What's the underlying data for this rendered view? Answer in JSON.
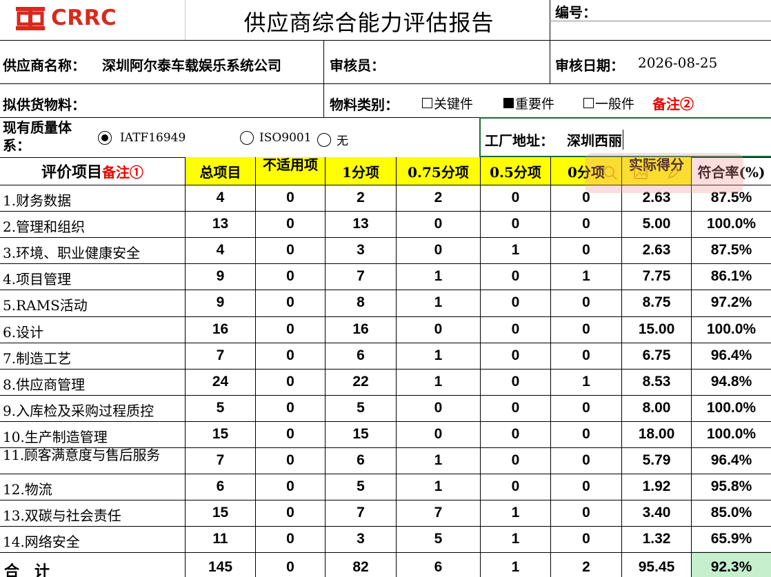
{
  "header": {
    "logo_text": "CRRC",
    "title": "供应商综合能力评估报告",
    "number_label": "编号："
  },
  "info": {
    "supplier_label": "供应商名称：",
    "supplier_name": "深圳阿尔泰车载娱乐系统公司",
    "reviewer_label": "审核员：",
    "review_date_label": "审核日期：",
    "review_date": "2026-08-25",
    "material_label": "拟供货物料：",
    "material_category_label": "物料类别：",
    "categories": [
      {
        "label": "关键件",
        "checked": false
      },
      {
        "label": "重要件",
        "checked": true
      },
      {
        "label": "一般件",
        "checked": false
      }
    ],
    "remark2": "备注②",
    "quality_system_label_1": "现有质量体",
    "quality_system_label_2": "系：",
    "quality_systems": [
      {
        "label": "IATF16949",
        "selected": true
      },
      {
        "label": "ISO9001",
        "selected": false
      },
      {
        "label": "无",
        "selected": false
      }
    ],
    "factory_address_label": "工厂地址：",
    "factory_address": "深圳西丽"
  },
  "table": {
    "header": {
      "item": "评价项目",
      "item_remark": "备注①",
      "total": "总项目",
      "na": "不适用项",
      "one": "1分项",
      "three_quarter": "0.75分项",
      "half": "0.5分项",
      "zero": "0分项",
      "score": "实际得分",
      "rate": "符合率(%)"
    },
    "rows": [
      {
        "name": "1.财务数据",
        "total": "4",
        "na": "0",
        "one": "2",
        "tq": "2",
        "half": "0",
        "zero": "0",
        "score": "2.63",
        "rate": "87.5%"
      },
      {
        "name": "2.管理和组织",
        "total": "13",
        "na": "0",
        "one": "13",
        "tq": "0",
        "half": "0",
        "zero": "0",
        "score": "5.00",
        "rate": "100.0%"
      },
      {
        "name": "3.环境、职业健康安全",
        "total": "4",
        "na": "0",
        "one": "3",
        "tq": "0",
        "half": "1",
        "zero": "0",
        "score": "2.63",
        "rate": "87.5%"
      },
      {
        "name": "4.项目管理",
        "total": "9",
        "na": "0",
        "one": "7",
        "tq": "1",
        "half": "0",
        "zero": "1",
        "score": "7.75",
        "rate": "86.1%"
      },
      {
        "name": "5.RAMS活动",
        "total": "9",
        "na": "0",
        "one": "8",
        "tq": "1",
        "half": "0",
        "zero": "0",
        "score": "8.75",
        "rate": "97.2%"
      },
      {
        "name": "6.设计",
        "total": "16",
        "na": "0",
        "one": "16",
        "tq": "0",
        "half": "0",
        "zero": "0",
        "score": "15.00",
        "rate": "100.0%"
      },
      {
        "name": "7.制造工艺",
        "total": "7",
        "na": "0",
        "one": "6",
        "tq": "1",
        "half": "0",
        "zero": "0",
        "score": "6.75",
        "rate": "96.4%"
      },
      {
        "name": "8.供应商管理",
        "total": "24",
        "na": "0",
        "one": "22",
        "tq": "1",
        "half": "0",
        "zero": "1",
        "score": "8.53",
        "rate": "94.8%"
      },
      {
        "name": "9.入库检及采购过程质控",
        "total": "5",
        "na": "0",
        "one": "5",
        "tq": "0",
        "half": "0",
        "zero": "0",
        "score": "8.00",
        "rate": "100.0%"
      },
      {
        "name": "10.生产制造管理",
        "total": "15",
        "na": "0",
        "one": "15",
        "tq": "0",
        "half": "0",
        "zero": "0",
        "score": "18.00",
        "rate": "100.0%"
      },
      {
        "name": "11.顾客满意度与售后服务",
        "total": "7",
        "na": "0",
        "one": "6",
        "tq": "1",
        "half": "0",
        "zero": "0",
        "score": "5.79",
        "rate": "96.4%"
      },
      {
        "name": "12.物流",
        "total": "6",
        "na": "0",
        "one": "5",
        "tq": "1",
        "half": "0",
        "zero": "0",
        "score": "1.92",
        "rate": "95.8%"
      },
      {
        "name": "13.双碳与社会责任",
        "total": "15",
        "na": "0",
        "one": "7",
        "tq": "7",
        "half": "1",
        "zero": "0",
        "score": "3.40",
        "rate": "85.0%"
      },
      {
        "name": "14.网络安全",
        "total": "11",
        "na": "0",
        "one": "3",
        "tq": "5",
        "half": "1",
        "zero": "0",
        "score": "1.32",
        "rate": "65.9%"
      }
    ],
    "total_row": {
      "name": "合　计",
      "total": "145",
      "na": "0",
      "one": "82",
      "tq": "6",
      "half": "1",
      "zero": "2",
      "score": "95.45",
      "rate": "92.3%"
    }
  },
  "toolbar_icons": [
    "search-icon",
    "image-icon",
    "edit-icon"
  ],
  "colors": {
    "brand": "#d52b1e",
    "header_fill": "#ffff00",
    "total_rate_fill": "#c6efce",
    "remark": "#ee0000"
  }
}
